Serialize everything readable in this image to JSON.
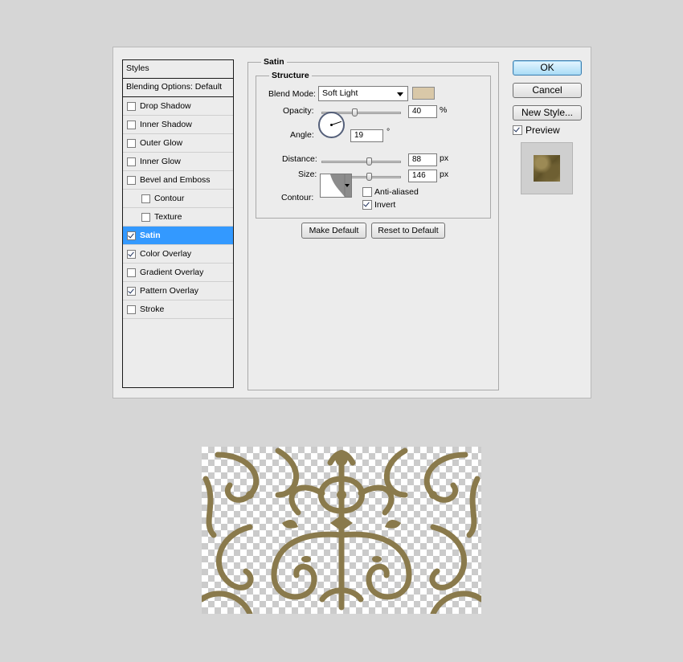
{
  "styles": {
    "header": "Styles",
    "blending_options": "Blending Options: Default",
    "items": [
      {
        "label": "Drop Shadow",
        "checked": false,
        "sub": false,
        "selected": false
      },
      {
        "label": "Inner Shadow",
        "checked": false,
        "sub": false,
        "selected": false
      },
      {
        "label": "Outer Glow",
        "checked": false,
        "sub": false,
        "selected": false
      },
      {
        "label": "Inner Glow",
        "checked": false,
        "sub": false,
        "selected": false
      },
      {
        "label": "Bevel and Emboss",
        "checked": false,
        "sub": false,
        "selected": false
      },
      {
        "label": "Contour",
        "checked": false,
        "sub": true,
        "selected": false
      },
      {
        "label": "Texture",
        "checked": false,
        "sub": true,
        "selected": false
      },
      {
        "label": "Satin",
        "checked": true,
        "sub": false,
        "selected": true
      },
      {
        "label": "Color Overlay",
        "checked": true,
        "sub": false,
        "selected": false
      },
      {
        "label": "Gradient Overlay",
        "checked": false,
        "sub": false,
        "selected": false
      },
      {
        "label": "Pattern Overlay",
        "checked": true,
        "sub": false,
        "selected": false
      },
      {
        "label": "Stroke",
        "checked": false,
        "sub": false,
        "selected": false
      }
    ]
  },
  "satin": {
    "title": "Satin",
    "structure_title": "Structure",
    "blend_mode_label": "Blend Mode:",
    "blend_mode_value": "Soft Light",
    "color": "#d9c8a8",
    "opacity_label": "Opacity:",
    "opacity_value": "40",
    "opacity_unit": "%",
    "opacity_fraction": 0.4,
    "angle_label": "Angle:",
    "angle_value": "19",
    "angle_unit": "°",
    "distance_label": "Distance:",
    "distance_value": "88",
    "distance_unit": "px",
    "distance_fraction": 0.6,
    "size_label": "Size:",
    "size_value": "146",
    "size_unit": "px",
    "size_fraction": 0.6,
    "contour_label": "Contour:",
    "anti_aliased_label": "Anti-aliased",
    "anti_aliased": false,
    "invert_label": "Invert",
    "invert": true,
    "make_default": "Make Default",
    "reset_default": "Reset to Default"
  },
  "buttons": {
    "ok": "OK",
    "cancel": "Cancel",
    "new_style": "New Style...",
    "preview_label": "Preview",
    "preview_checked": true
  },
  "colors": {
    "selection": "#3399ff",
    "ornament": "#8a7a4c"
  }
}
